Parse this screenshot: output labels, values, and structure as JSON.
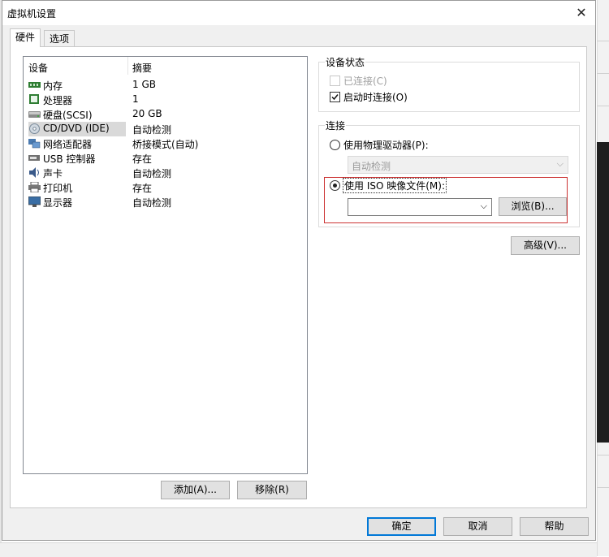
{
  "window": {
    "title": "虚拟机设置",
    "close_glyph": "✕"
  },
  "tabs": [
    {
      "label": "硬件"
    },
    {
      "label": "选项"
    }
  ],
  "devices": {
    "col_device": "设备",
    "col_summary": "摘要",
    "items": [
      {
        "name": "内存",
        "summary": "1 GB",
        "icon": "memory-icon"
      },
      {
        "name": "处理器",
        "summary": "1",
        "icon": "cpu-icon"
      },
      {
        "name": "硬盘(SCSI)",
        "summary": "20 GB",
        "icon": "hard-disk-icon"
      },
      {
        "name": "CD/DVD (IDE)",
        "summary": "自动检测",
        "icon": "cd-dvd-icon"
      },
      {
        "name": "网络适配器",
        "summary": "桥接模式(自动)",
        "icon": "network-adapter-icon"
      },
      {
        "name": "USB 控制器",
        "summary": "存在",
        "icon": "usb-icon"
      },
      {
        "name": "声卡",
        "summary": "自动检测",
        "icon": "sound-card-icon"
      },
      {
        "name": "打印机",
        "summary": "存在",
        "icon": "printer-icon"
      },
      {
        "name": "显示器",
        "summary": "自动检测",
        "icon": "display-icon"
      }
    ],
    "selected_index": 3
  },
  "list_buttons": {
    "add": "添加(A)...",
    "remove": "移除(R)"
  },
  "device_status": {
    "title": "设备状态",
    "connected_label": "已连接(C)",
    "connected_checked": false,
    "connected_enabled": false,
    "connect_at_power_on_label": "启动时连接(O)",
    "connect_at_power_on_checked": true
  },
  "connection": {
    "title": "连接",
    "physical_drive_label": "使用物理驱动器(P):",
    "physical_drive_value": "自动检测",
    "iso_label": "使用 ISO 映像文件(M):",
    "iso_value": "",
    "browse_label": "浏览(B)...",
    "selected_option": "iso"
  },
  "advanced_label": "高级(V)...",
  "footer": {
    "ok": "确定",
    "cancel": "取消",
    "help": "帮助"
  },
  "colors": {
    "accent": "#0078d7",
    "highlight_box": "#cc3333",
    "selected_row": "#d9d9d9"
  }
}
